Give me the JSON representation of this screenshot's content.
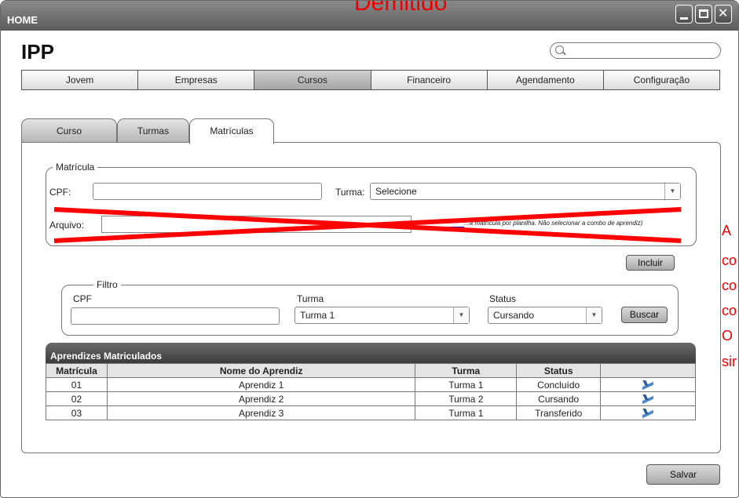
{
  "window": {
    "title": "HOME"
  },
  "overlay": {
    "heading": "Demitido",
    "side_lines": [
      "A",
      "co",
      "co",
      "co",
      "O",
      "sir"
    ]
  },
  "app": {
    "title": "IPP"
  },
  "search": {
    "placeholder": ""
  },
  "nav": {
    "items": [
      "Jovem",
      "Empresas",
      "Cursos",
      "Financeiro",
      "Agendamento",
      "Configuração"
    ],
    "active": "Cursos"
  },
  "tabs": [
    "Curso",
    "Turmas",
    "Matrículas"
  ],
  "matricula": {
    "legend": "Matrícula",
    "cpf_label": "CPF:",
    "cpf_value": "",
    "turma_label": "Turma:",
    "turma_value": "Selecione",
    "arquivo_label": "Arquivo:",
    "arquivo_value": "",
    "note": "...a matrícula por planilha. Não selecionar a combo de aprendiz)",
    "incluir_label": "Incluir"
  },
  "filtro": {
    "legend": "Filtro",
    "cpf_label": "CPF",
    "cpf_value": "",
    "turma_label": "Turma",
    "turma_value": "Turma 1",
    "status_label": "Status",
    "status_value": "Cursando",
    "buscar_label": "Buscar"
  },
  "table": {
    "title": "Aprendizes Matriculados",
    "columns": [
      "Matrícula",
      "Nome do Aprendiz",
      "Turma",
      "Status",
      ""
    ],
    "rows": [
      [
        "01",
        "Aprendiz 1",
        "Turma 1",
        "Concluído"
      ],
      [
        "02",
        "Aprendiz 2",
        "Turma 2",
        "Cursando"
      ],
      [
        "03",
        "Aprendiz 3",
        "Turma 1",
        "Transferido"
      ]
    ]
  },
  "footer": {
    "salvar_label": "Salvar"
  },
  "colors": {
    "strike": "#ff0000",
    "overlay_text": "#e00000",
    "titlebar": "#6e6e6e"
  },
  "icons": {
    "edit": "edit-pencil-icon",
    "search": "search-icon"
  }
}
